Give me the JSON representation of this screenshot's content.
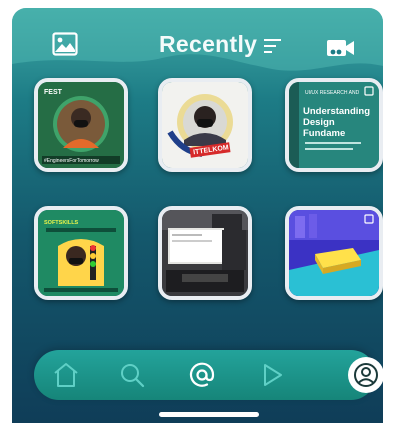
{
  "header": {
    "title": "Recently",
    "gallery_icon": "image-gallery-icon",
    "sort_icon": "sort-lines-icon",
    "video_icon": "video-camera-icon"
  },
  "photos": [
    {
      "id": "photo-1",
      "caption": "#EngineersForTomorrow",
      "badge": "FEST"
    },
    {
      "id": "photo-2",
      "caption": "ITTELKOM",
      "badge": ""
    },
    {
      "id": "photo-3",
      "caption": "Understanding Design Fundame",
      "badge": "UI/UX RESEARCH AND"
    },
    {
      "id": "photo-4",
      "caption": "SOFTSKILLS",
      "badge": ""
    },
    {
      "id": "photo-5",
      "caption": "",
      "badge": ""
    },
    {
      "id": "photo-6",
      "caption": "",
      "badge": ""
    }
  ],
  "nav": {
    "items": [
      {
        "name": "home",
        "icon": "home-icon"
      },
      {
        "name": "search",
        "icon": "search-icon"
      },
      {
        "name": "mentions",
        "icon": "at-sign-icon"
      },
      {
        "name": "play",
        "icon": "play-icon"
      },
      {
        "name": "profile",
        "icon": "profile-icon"
      }
    ]
  },
  "colors": {
    "bg_top": "#3fa9a5",
    "bg_bottom": "#0f3d58",
    "nav_bg": "#1e9a8f",
    "tile_border": "#e9edf2"
  }
}
